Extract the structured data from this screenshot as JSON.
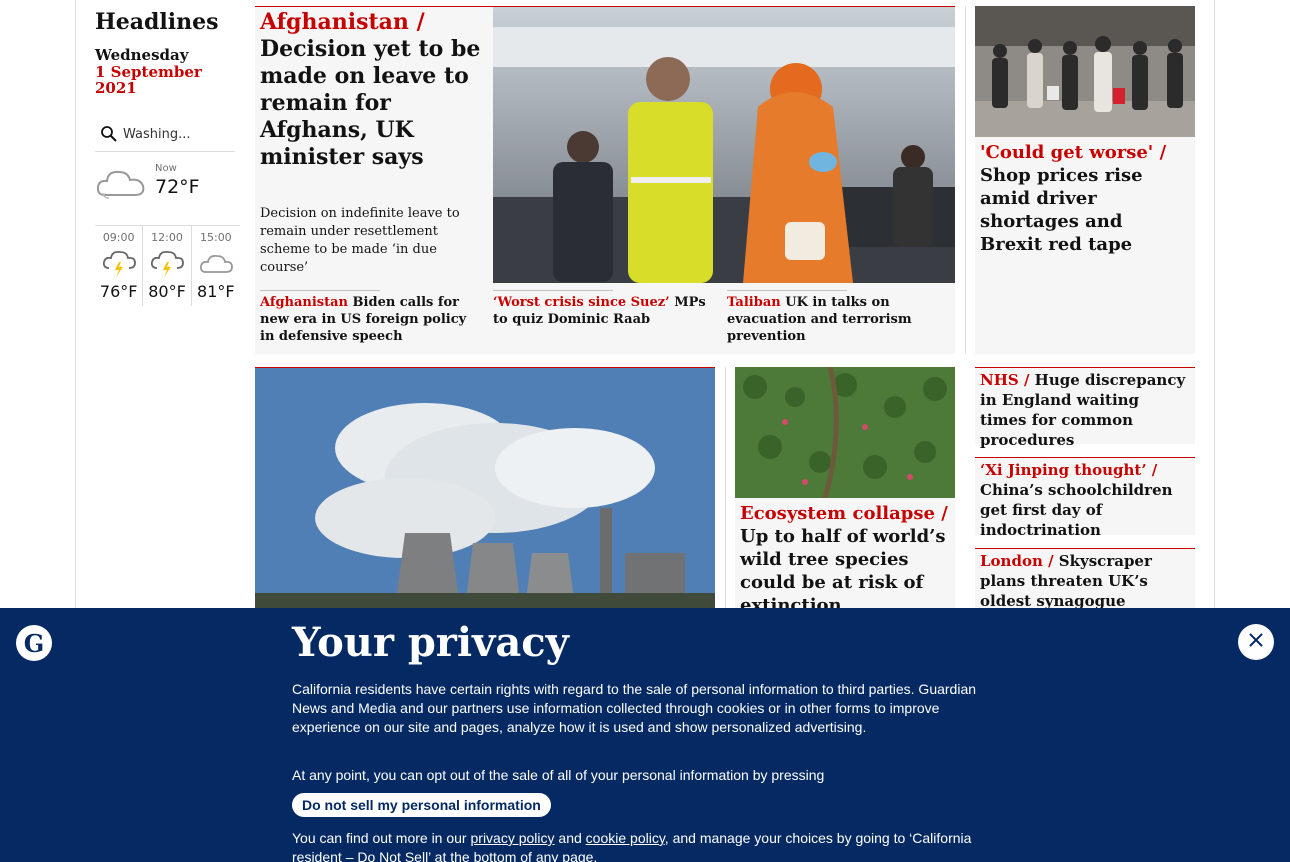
{
  "section": {
    "title": "Headlines",
    "day": "Wednesday",
    "date": "1 September 2021"
  },
  "weather": {
    "search_placeholder": "Washing...",
    "now_label": "Now",
    "now_temp": "72°F",
    "now_icon": "cloud-icon",
    "forecast": [
      {
        "time": "09:00",
        "temp": "76°F",
        "icon": "thunder-cloud-icon"
      },
      {
        "time": "12:00",
        "temp": "80°F",
        "icon": "thunder-cloud-icon"
      },
      {
        "time": "15:00",
        "temp": "81°F",
        "icon": "cloud-icon"
      }
    ]
  },
  "lead": {
    "kicker": "Afghanistan /",
    "headline": "Decision yet to be made on leave to remain for Afghans, UK minister says",
    "trail": "Decision on indefinite leave to remain under resettlement scheme to be made ‘in due course’",
    "sublinks": [
      {
        "kicker": "Afghanistan",
        "text": "Biden calls for new era in US foreign policy in defensive speech"
      },
      {
        "kicker": "‘Worst crisis since Suez’",
        "text": "MPs to quiz Dominic Raab"
      },
      {
        "kicker": "Taliban",
        "text": "UK in talks on evacuation and terrorism prevention"
      }
    ]
  },
  "right_top": {
    "kicker": "'Could get worse' /",
    "headline": "Shop prices rise amid driver shortages and Brexit red tape"
  },
  "eco": {
    "kicker": "Ecosystem collapse /",
    "headline": "Up to half of world’s wild tree species could be at risk of extinction"
  },
  "small_cards": [
    {
      "kicker": "NHS /",
      "headline": "Huge discrepancy in England waiting times for common procedures"
    },
    {
      "kicker": "‘Xi Jinping thought’ /",
      "headline": "China’s schoolchildren get first day of indoctrination"
    },
    {
      "kicker": "London /",
      "headline": "Skyscraper plans threaten UK’s oldest synagogue"
    }
  ],
  "privacy": {
    "title": "Your privacy",
    "para1": "California residents have certain rights with regard to the sale of personal information to third parties. Guardian News and Media and our partners use information collected through cookies or in other forms to improve experience on our site and pages, analyze how it is used and show personalized advertising.",
    "para2": "At any point, you can opt out of the sale of all of your personal information by pressing",
    "button": "Do not sell my personal information",
    "para3_start": "You can find out more in our",
    "privacy_link": "privacy policy",
    "and": "and",
    "cookie_link": "cookie policy",
    "para3_end": ", and manage your choices by going to ‘California resident – Do Not Sell’ at the bottom of any page.",
    "brand_color": "#052962"
  },
  "colors": {
    "accent": "#c70000",
    "card_bg": "#f6f6f6"
  }
}
